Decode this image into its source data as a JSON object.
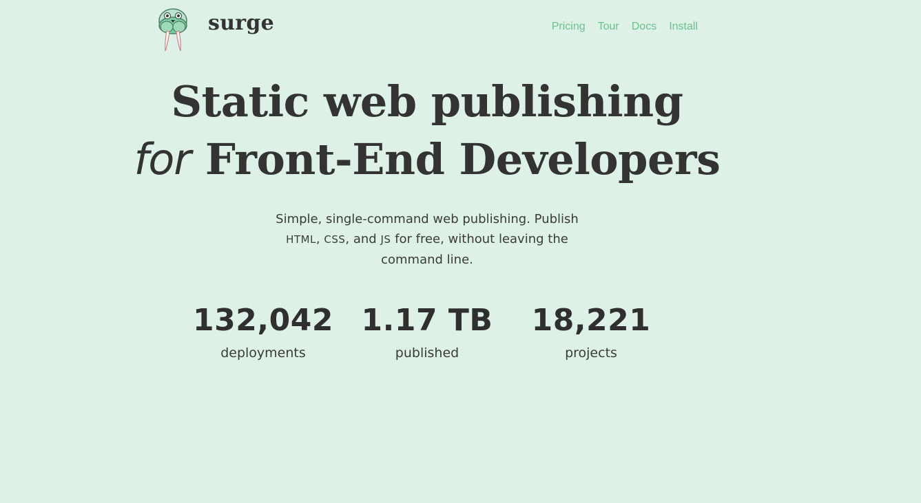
{
  "header": {
    "brand": "surge",
    "logo_icon": "walrus-mascot-icon",
    "nav": [
      {
        "label": "Pricing"
      },
      {
        "label": "Tour"
      },
      {
        "label": "Docs"
      },
      {
        "label": "Install"
      }
    ]
  },
  "hero": {
    "line1": "Static web publishing",
    "line2_italic": "for",
    "line2_rest": "Front-End Developers"
  },
  "subtitle": {
    "part1": "Simple, single-command web publishing. Publish",
    "html": "HTML",
    "comma1": ",",
    "css": "CSS",
    "and": ", and",
    "js": "JS",
    "part2": "for free, without leaving the command line."
  },
  "stats": [
    {
      "value": "132,042",
      "label": "deployments"
    },
    {
      "value": "1.17 TB",
      "label": "published"
    },
    {
      "value": "18,221",
      "label": "projects"
    }
  ],
  "colors": {
    "background": "#ddf1e6",
    "nav_link": "#6cc08f",
    "text": "#333333"
  }
}
